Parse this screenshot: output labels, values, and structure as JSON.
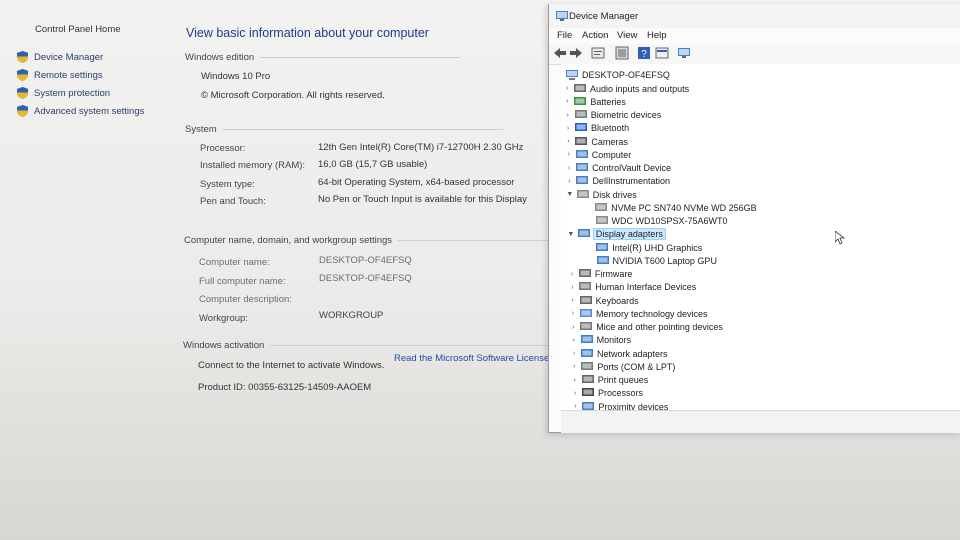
{
  "left_nav": {
    "home": "Control Panel Home",
    "items": [
      {
        "label": "Device Manager"
      },
      {
        "label": "Remote settings"
      },
      {
        "label": "System protection"
      },
      {
        "label": "Advanced system settings"
      }
    ]
  },
  "main": {
    "title": "View basic information about your computer",
    "edition": {
      "heading": "Windows edition",
      "name": "Windows 10 Pro",
      "copyright": "© Microsoft Corporation. All rights reserved."
    },
    "system": {
      "heading": "System",
      "rows": [
        {
          "label": "Processor:",
          "value": "12th Gen Intel(R) Core(TM) i7-12700H   2.30 GHz"
        },
        {
          "label": "Installed memory (RAM):",
          "value": "16,0 GB (15,7 GB usable)"
        },
        {
          "label": "System type:",
          "value": "64-bit Operating System, x64-based processor"
        },
        {
          "label": "Pen and Touch:",
          "value": "No Pen or Touch Input is available for this Display"
        }
      ]
    },
    "computer_name": {
      "heading": "Computer name, domain, and workgroup settings",
      "rows": [
        {
          "label": "Computer name:",
          "value": "DESKTOP-OF4EFSQ"
        },
        {
          "label": "Full computer name:",
          "value": "DESKTOP-OF4EFSQ"
        },
        {
          "label": "Computer description:",
          "value": ""
        },
        {
          "label": "Workgroup:",
          "value": "WORKGROUP"
        }
      ]
    },
    "activation": {
      "heading": "Windows activation",
      "text": "Connect to the Internet to activate Windows.",
      "link": "Read the Microsoft Software License Terms",
      "product_id": "Product ID: 00355-63125-14509-AAOEM"
    }
  },
  "device_manager": {
    "title": "Device Manager",
    "menu": [
      "File",
      "Action",
      "View",
      "Help"
    ],
    "root": "DESKTOP-OF4EFSQ",
    "tree": [
      {
        "label": "Audio inputs and outputs",
        "level": 1,
        "icon": "speaker-icon"
      },
      {
        "label": "Batteries",
        "level": 1,
        "icon": "battery-icon"
      },
      {
        "label": "Biometric devices",
        "level": 1,
        "icon": "fingerprint-icon"
      },
      {
        "label": "Bluetooth",
        "level": 1,
        "icon": "bluetooth-icon"
      },
      {
        "label": "Cameras",
        "level": 1,
        "icon": "camera-icon"
      },
      {
        "label": "Computer",
        "level": 1,
        "icon": "computer-icon"
      },
      {
        "label": "ControlVault Device",
        "level": 1,
        "icon": "device-icon"
      },
      {
        "label": "DellInstrumentation",
        "level": 1,
        "icon": "device-icon"
      },
      {
        "label": "Disk drives",
        "level": 1,
        "icon": "disk-icon",
        "expanded": true
      },
      {
        "label": "NVMe PC SN740 NVMe WD 256GB",
        "level": 2,
        "icon": "disk-icon"
      },
      {
        "label": "WDC WD10SPSX-75A6WT0",
        "level": 2,
        "icon": "disk-icon"
      },
      {
        "label": "Display adapters",
        "level": 1,
        "icon": "monitor-icon",
        "expanded": true,
        "selected": true
      },
      {
        "label": "Intel(R) UHD Graphics",
        "level": 2,
        "icon": "monitor-icon"
      },
      {
        "label": "NVIDIA T600 Laptop GPU",
        "level": 2,
        "icon": "monitor-icon"
      },
      {
        "label": "Firmware",
        "level": 1,
        "icon": "chip-icon"
      },
      {
        "label": "Human Interface Devices",
        "level": 1,
        "icon": "hid-icon"
      },
      {
        "label": "Keyboards",
        "level": 1,
        "icon": "keyboard-icon"
      },
      {
        "label": "Memory technology devices",
        "level": 1,
        "icon": "memory-icon"
      },
      {
        "label": "Mice and other pointing devices",
        "level": 1,
        "icon": "mouse-icon"
      },
      {
        "label": "Monitors",
        "level": 1,
        "icon": "monitor-icon"
      },
      {
        "label": "Network adapters",
        "level": 1,
        "icon": "network-icon"
      },
      {
        "label": "Ports (COM & LPT)",
        "level": 1,
        "icon": "port-icon"
      },
      {
        "label": "Print queues",
        "level": 1,
        "icon": "printer-icon"
      },
      {
        "label": "Processors",
        "level": 1,
        "icon": "processor-icon"
      },
      {
        "label": "Proximity devices",
        "level": 1,
        "icon": "device-icon"
      }
    ]
  }
}
